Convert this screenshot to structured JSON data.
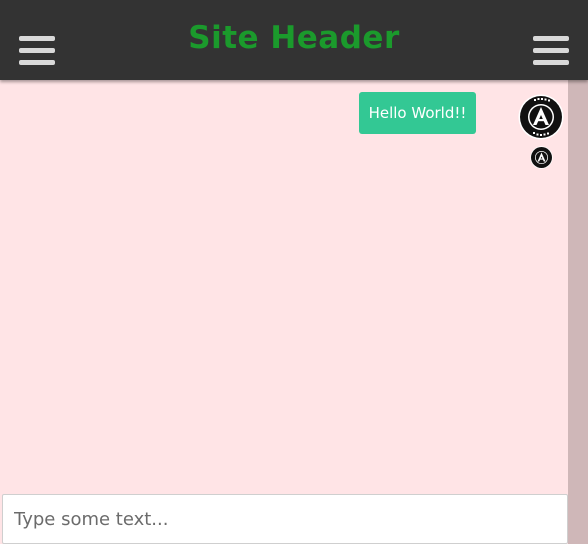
{
  "header": {
    "title": "Site Header",
    "left_menu_icon": "hamburger-menu-icon",
    "right_menu_icon": "hamburger-menu-icon"
  },
  "chat": {
    "messages": [
      {
        "text": "Hello World!!",
        "avatar_icon": "avatar-icon"
      }
    ],
    "read_receipt_icon": "avatar-small-icon"
  },
  "composer": {
    "value": "",
    "placeholder": "Type some text..."
  },
  "colors": {
    "header_background": "#333333",
    "title": "#1b9a2c",
    "chat_background": "#ffe4e6",
    "bubble": "#33c894",
    "scrollbar_track": "#cfb7b8"
  }
}
